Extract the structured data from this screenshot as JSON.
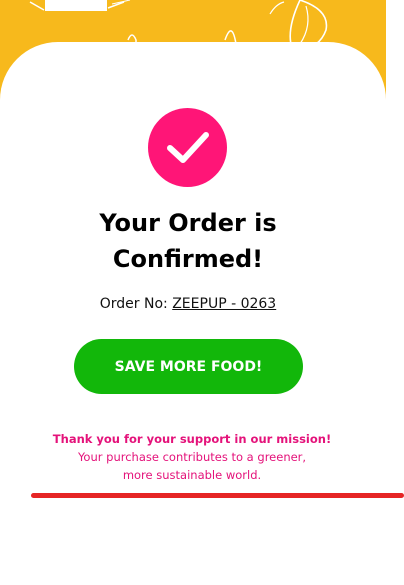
{
  "confirmation": {
    "title_line1": "Your Order is",
    "title_line2": "Confirmed!",
    "order_label": "Order No: ",
    "order_number": "ZEEPUP - 0263",
    "check_icon": "checkmark-icon"
  },
  "actions": {
    "save_more_label": "SAVE MORE FOOD!"
  },
  "message": {
    "thanks": "Thank you for your support in our mission!",
    "detail": "Your purchase contributes to a greener, more sustainable world."
  },
  "colors": {
    "header_yellow": "#f7b91c",
    "accent_pink": "#ff1577",
    "button_green": "#12b70a",
    "divider_red": "#e62525",
    "message_pink": "#e4127a"
  }
}
